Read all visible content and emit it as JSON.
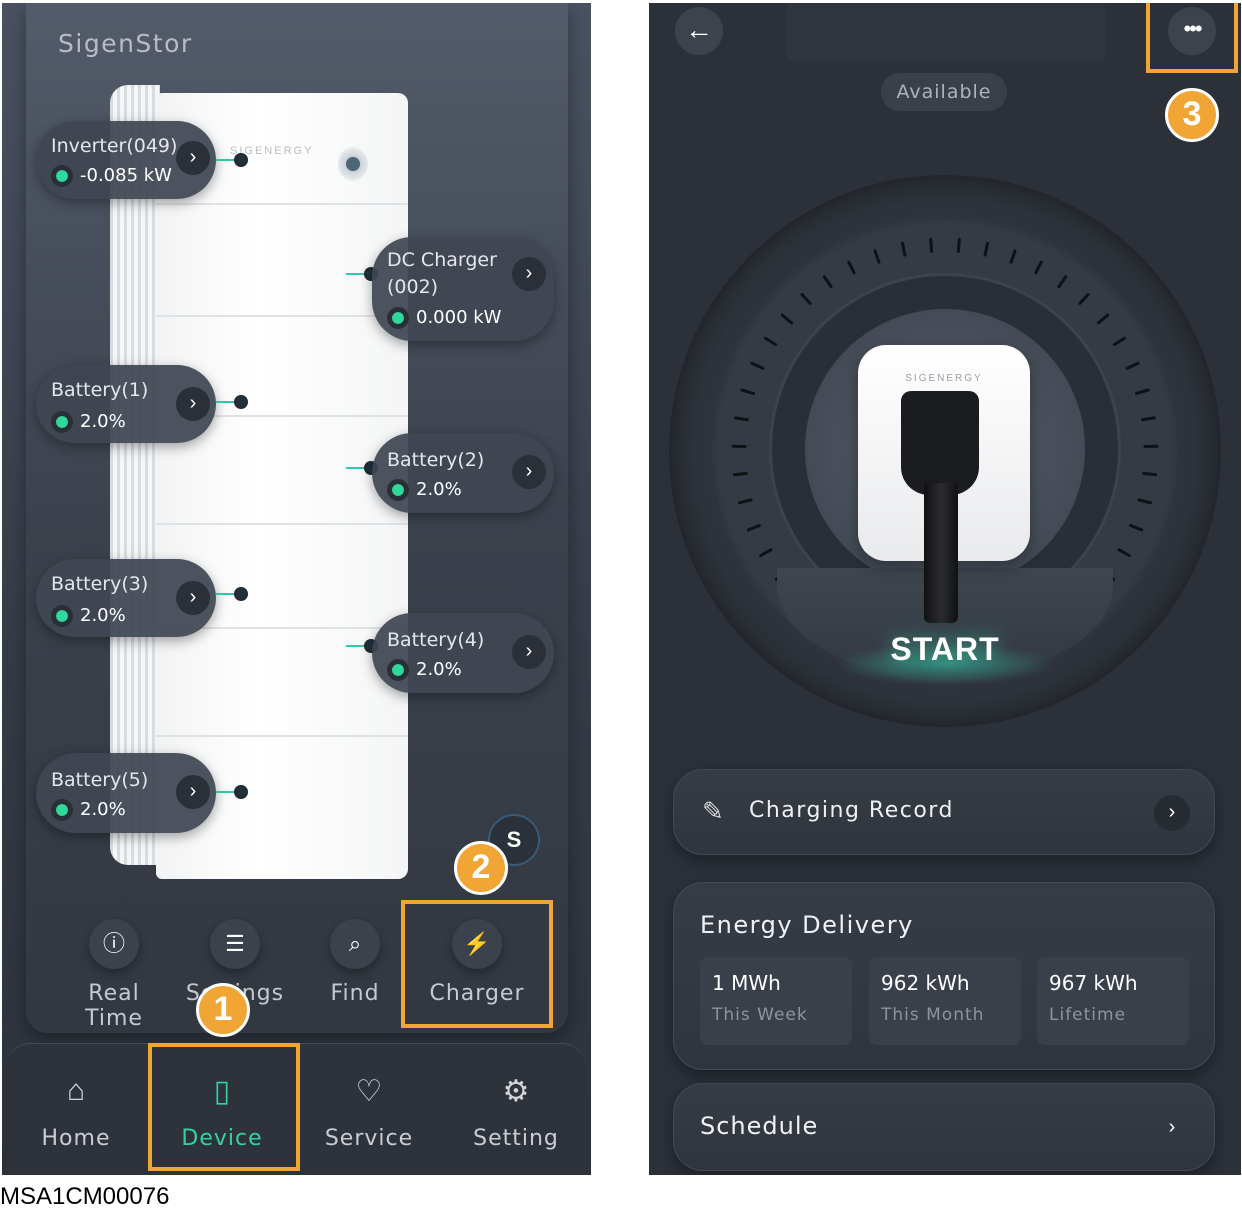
{
  "left": {
    "brand": "SigenStor",
    "tower_logo": "SIGENERGY",
    "chips": [
      {
        "name": "Inverter(049)",
        "value": "-0.085 kW"
      },
      {
        "name": "DC Charger",
        "name2": "(002)",
        "value": "0.000 kW"
      },
      {
        "name": "Battery(1)",
        "value": "2.0%"
      },
      {
        "name": "Battery(2)",
        "value": "2.0%"
      },
      {
        "name": "Battery(3)",
        "value": "2.0%"
      },
      {
        "name": "Battery(4)",
        "value": "2.0%"
      },
      {
        "name": "Battery(5)",
        "value": "2.0%"
      }
    ],
    "s_badge": "S",
    "tools": [
      {
        "label": "Real Time",
        "icon": "info-icon"
      },
      {
        "label": "Settings",
        "icon": "sliders-icon"
      },
      {
        "label": "Find",
        "icon": "find-icon"
      },
      {
        "label": "Charger",
        "icon": "charger-icon"
      }
    ],
    "nav": [
      {
        "label": "Home",
        "icon": "home-icon"
      },
      {
        "label": "Device",
        "icon": "device-icon",
        "active": true
      },
      {
        "label": "Service",
        "icon": "service-icon"
      },
      {
        "label": "Setting",
        "icon": "gear-icon"
      }
    ]
  },
  "right": {
    "status": "Available",
    "plug_logo": "SIGENERGY",
    "start_label": "START",
    "charging_record": "Charging Record",
    "energy_title": "Energy Delivery",
    "stats": [
      {
        "value": "1 MWh",
        "label": "This Week"
      },
      {
        "value": "962 kWh",
        "label": "This Month"
      },
      {
        "value": "967 kWh",
        "label": "Lifetime"
      }
    ],
    "schedule": "Schedule"
  },
  "callouts": [
    "1",
    "2",
    "3"
  ],
  "caption": "MSA1CM00076",
  "colors": {
    "highlight": "#f0a534",
    "accent": "#32d1a0",
    "dot": "#2fd89b"
  }
}
